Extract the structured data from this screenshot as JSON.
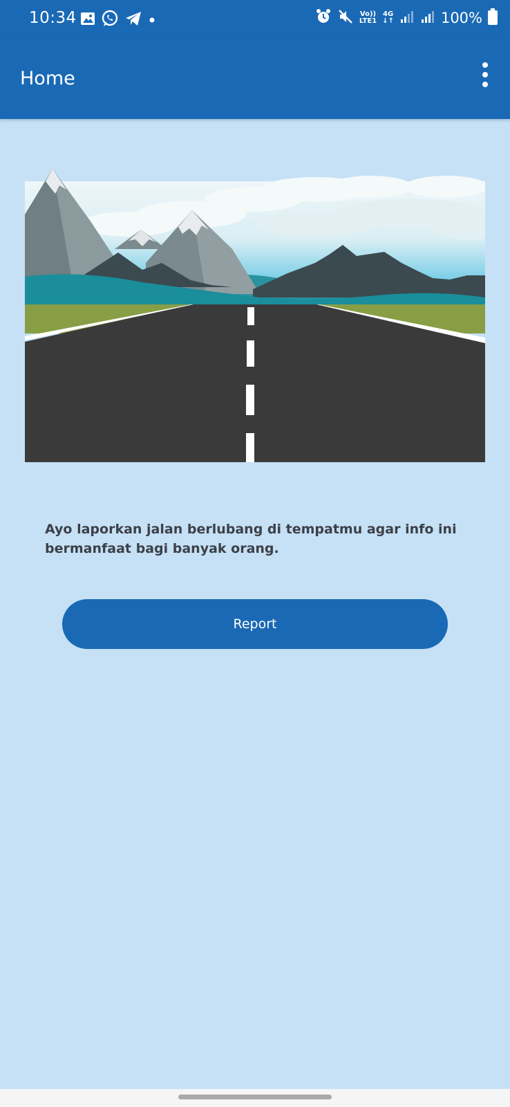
{
  "status_bar": {
    "time": "10:34",
    "battery": "100%",
    "net_top": "Vo))",
    "net_bottom": "LTE1",
    "net_type": "4G"
  },
  "app_bar": {
    "title": "Home"
  },
  "main": {
    "info_text": "Ayo laporkan jalan berlubang di tempatmu agar info ini bermanfaat bagi banyak orang.",
    "report_label": "Report"
  },
  "colors": {
    "primary": "#1A69B5",
    "background": "#C6E1F6",
    "text": "#3C4048"
  }
}
